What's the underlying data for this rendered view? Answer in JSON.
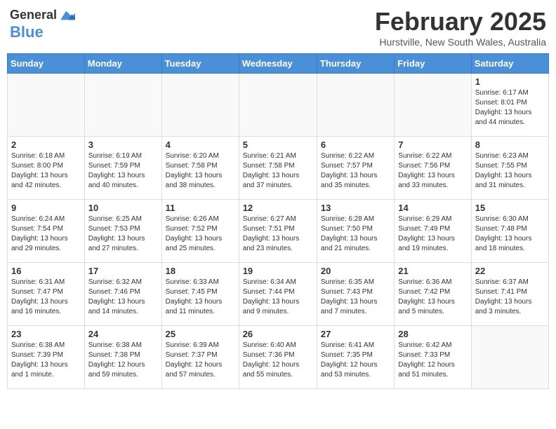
{
  "header": {
    "logo_line1": "General",
    "logo_line2": "Blue",
    "month": "February 2025",
    "location": "Hurstville, New South Wales, Australia"
  },
  "days_of_week": [
    "Sunday",
    "Monday",
    "Tuesday",
    "Wednesday",
    "Thursday",
    "Friday",
    "Saturday"
  ],
  "weeks": [
    [
      {
        "day": "",
        "info": ""
      },
      {
        "day": "",
        "info": ""
      },
      {
        "day": "",
        "info": ""
      },
      {
        "day": "",
        "info": ""
      },
      {
        "day": "",
        "info": ""
      },
      {
        "day": "",
        "info": ""
      },
      {
        "day": "1",
        "info": "Sunrise: 6:17 AM\nSunset: 8:01 PM\nDaylight: 13 hours\nand 44 minutes."
      }
    ],
    [
      {
        "day": "2",
        "info": "Sunrise: 6:18 AM\nSunset: 8:00 PM\nDaylight: 13 hours\nand 42 minutes."
      },
      {
        "day": "3",
        "info": "Sunrise: 6:19 AM\nSunset: 7:59 PM\nDaylight: 13 hours\nand 40 minutes."
      },
      {
        "day": "4",
        "info": "Sunrise: 6:20 AM\nSunset: 7:58 PM\nDaylight: 13 hours\nand 38 minutes."
      },
      {
        "day": "5",
        "info": "Sunrise: 6:21 AM\nSunset: 7:58 PM\nDaylight: 13 hours\nand 37 minutes."
      },
      {
        "day": "6",
        "info": "Sunrise: 6:22 AM\nSunset: 7:57 PM\nDaylight: 13 hours\nand 35 minutes."
      },
      {
        "day": "7",
        "info": "Sunrise: 6:22 AM\nSunset: 7:56 PM\nDaylight: 13 hours\nand 33 minutes."
      },
      {
        "day": "8",
        "info": "Sunrise: 6:23 AM\nSunset: 7:55 PM\nDaylight: 13 hours\nand 31 minutes."
      }
    ],
    [
      {
        "day": "9",
        "info": "Sunrise: 6:24 AM\nSunset: 7:54 PM\nDaylight: 13 hours\nand 29 minutes."
      },
      {
        "day": "10",
        "info": "Sunrise: 6:25 AM\nSunset: 7:53 PM\nDaylight: 13 hours\nand 27 minutes."
      },
      {
        "day": "11",
        "info": "Sunrise: 6:26 AM\nSunset: 7:52 PM\nDaylight: 13 hours\nand 25 minutes."
      },
      {
        "day": "12",
        "info": "Sunrise: 6:27 AM\nSunset: 7:51 PM\nDaylight: 13 hours\nand 23 minutes."
      },
      {
        "day": "13",
        "info": "Sunrise: 6:28 AM\nSunset: 7:50 PM\nDaylight: 13 hours\nand 21 minutes."
      },
      {
        "day": "14",
        "info": "Sunrise: 6:29 AM\nSunset: 7:49 PM\nDaylight: 13 hours\nand 19 minutes."
      },
      {
        "day": "15",
        "info": "Sunrise: 6:30 AM\nSunset: 7:48 PM\nDaylight: 13 hours\nand 18 minutes."
      }
    ],
    [
      {
        "day": "16",
        "info": "Sunrise: 6:31 AM\nSunset: 7:47 PM\nDaylight: 13 hours\nand 16 minutes."
      },
      {
        "day": "17",
        "info": "Sunrise: 6:32 AM\nSunset: 7:46 PM\nDaylight: 13 hours\nand 14 minutes."
      },
      {
        "day": "18",
        "info": "Sunrise: 6:33 AM\nSunset: 7:45 PM\nDaylight: 13 hours\nand 11 minutes."
      },
      {
        "day": "19",
        "info": "Sunrise: 6:34 AM\nSunset: 7:44 PM\nDaylight: 13 hours\nand 9 minutes."
      },
      {
        "day": "20",
        "info": "Sunrise: 6:35 AM\nSunset: 7:43 PM\nDaylight: 13 hours\nand 7 minutes."
      },
      {
        "day": "21",
        "info": "Sunrise: 6:36 AM\nSunset: 7:42 PM\nDaylight: 13 hours\nand 5 minutes."
      },
      {
        "day": "22",
        "info": "Sunrise: 6:37 AM\nSunset: 7:41 PM\nDaylight: 13 hours\nand 3 minutes."
      }
    ],
    [
      {
        "day": "23",
        "info": "Sunrise: 6:38 AM\nSunset: 7:39 PM\nDaylight: 13 hours\nand 1 minute."
      },
      {
        "day": "24",
        "info": "Sunrise: 6:38 AM\nSunset: 7:38 PM\nDaylight: 12 hours\nand 59 minutes."
      },
      {
        "day": "25",
        "info": "Sunrise: 6:39 AM\nSunset: 7:37 PM\nDaylight: 12 hours\nand 57 minutes."
      },
      {
        "day": "26",
        "info": "Sunrise: 6:40 AM\nSunset: 7:36 PM\nDaylight: 12 hours\nand 55 minutes."
      },
      {
        "day": "27",
        "info": "Sunrise: 6:41 AM\nSunset: 7:35 PM\nDaylight: 12 hours\nand 53 minutes."
      },
      {
        "day": "28",
        "info": "Sunrise: 6:42 AM\nSunset: 7:33 PM\nDaylight: 12 hours\nand 51 minutes."
      },
      {
        "day": "",
        "info": ""
      }
    ]
  ]
}
